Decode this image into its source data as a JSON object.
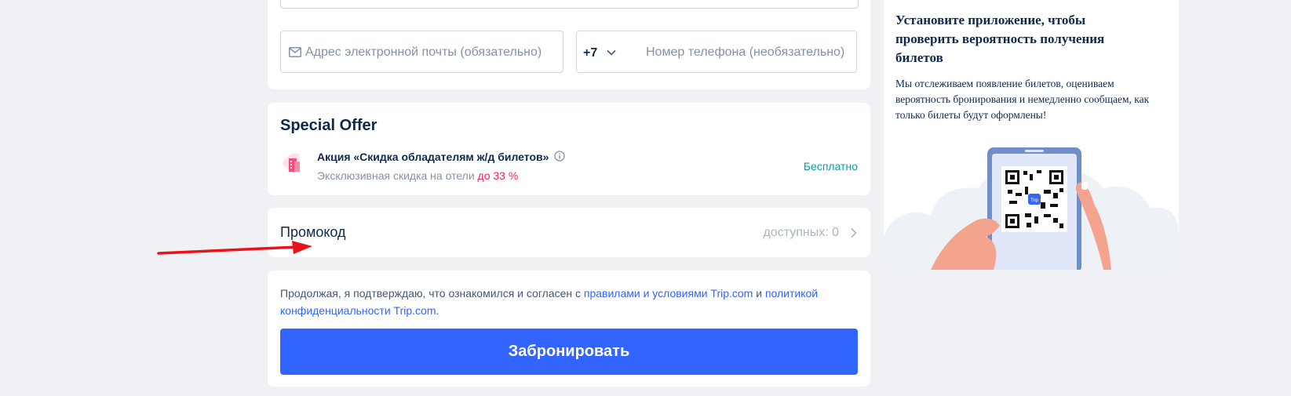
{
  "contact": {
    "email_placeholder": "Адрес электронной почты (обязательно)",
    "phone_code": "+7",
    "phone_placeholder": "Номер телефона (необязательно)"
  },
  "offer": {
    "title": "Special Offer",
    "name": "Акция «Скидка обладателям ж/д билетов»",
    "sub_prefix": "Эксклюзивная скидка на отели",
    "sub_highlight": "до 33 %",
    "price": "Бесплатно"
  },
  "promo": {
    "label": "Промокод",
    "available": "доступных: 0"
  },
  "agreement": {
    "text_1": "Продолжая, я подтверждаю, что ознакомился и согласен с",
    "link_terms": "правилами и условиями Trip.com",
    "text_and": "и",
    "link_privacy": "политикой конфиденциальности Trip.com",
    "text_end": "."
  },
  "book_button": "Забронировать",
  "app": {
    "title": "Установите приложение, чтобы проверить вероятность получения билетов",
    "description": "Мы отслеживаем появление билетов, оцениваем вероятность бронирования и немедленно сообщаем, как только билеты будут оформлены!",
    "qr_badge": "Trip"
  },
  "colors": {
    "accent": "#3264ff",
    "price": "#00a2a2",
    "highlight": "#e6245a",
    "annotation_arrow": "#e8141c"
  }
}
